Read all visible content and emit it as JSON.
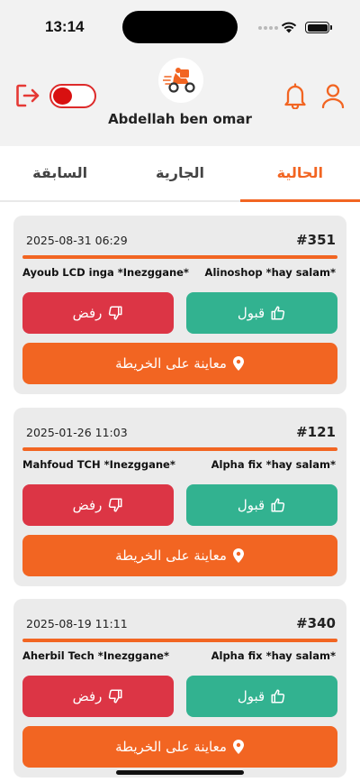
{
  "status": {
    "time": "13:14"
  },
  "header": {
    "username": "Abdellah ben omar"
  },
  "tabs": [
    {
      "label": "الحالية",
      "active": true
    },
    {
      "label": "الجارية",
      "active": false
    },
    {
      "label": "السابقة",
      "active": false
    }
  ],
  "orders": [
    {
      "id": "#351",
      "date": "2025-08-31 06:29",
      "from": "Ayoub LCD inga *Inezggane*",
      "to": "Alinoshop *hay salam*",
      "accept": "قبول",
      "reject": "رفض",
      "map": "معاينة على الخريطة"
    },
    {
      "id": "#121",
      "date": "2025-01-26 11:03",
      "from": "Mahfoud TCH *Inezggane*",
      "to": "Alpha fix *hay salam*",
      "accept": "قبول",
      "reject": "رفض",
      "map": "معاينة على الخريطة"
    },
    {
      "id": "#340",
      "date": "2025-08-19 11:11",
      "from": "Aherbil Tech *Inezggane*",
      "to": "Alpha fix *hay salam*",
      "accept": "قبول",
      "reject": "رفض",
      "map": "معاينة على الخريطة"
    }
  ],
  "icons": {
    "logout": "logout-icon",
    "toggle": "availability-toggle",
    "logo": "delivery-scooter-logo",
    "bell": "bell-icon",
    "user": "user-icon",
    "accept": "thumbs-up-icon",
    "reject": "thumbs-down-icon",
    "map": "map-pin-icon"
  },
  "colors": {
    "accent": "#f26522",
    "accept": "#32b290",
    "reject": "#dc3545",
    "toggle": "#d81010"
  }
}
